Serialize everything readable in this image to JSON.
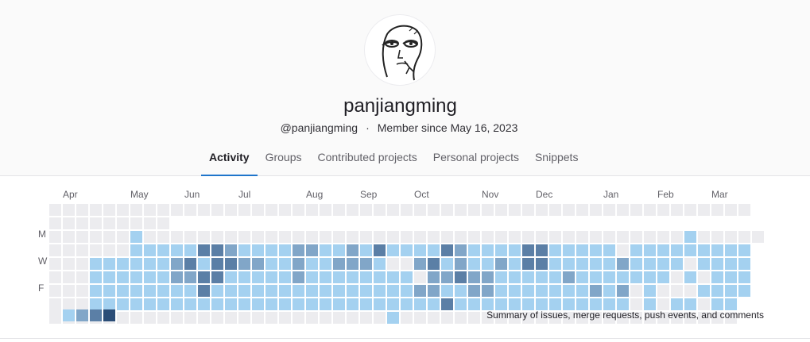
{
  "profile": {
    "username": "panjiangming",
    "handle": "@panjiangming",
    "separator": "·",
    "member_since": "Member since May 16, 2023"
  },
  "tabs": [
    {
      "label": "Activity",
      "active": true
    },
    {
      "label": "Groups",
      "active": false
    },
    {
      "label": "Contributed projects",
      "active": false
    },
    {
      "label": "Personal projects",
      "active": false
    },
    {
      "label": "Snippets",
      "active": false
    }
  ],
  "calendar": {
    "months": [
      {
        "label": "Apr",
        "week": 1
      },
      {
        "label": "May",
        "week": 6
      },
      {
        "label": "Jun",
        "week": 10
      },
      {
        "label": "Jul",
        "week": 14
      },
      {
        "label": "Aug",
        "week": 19
      },
      {
        "label": "Sep",
        "week": 23
      },
      {
        "label": "Oct",
        "week": 27
      },
      {
        "label": "Nov",
        "week": 32
      },
      {
        "label": "Dec",
        "week": 36
      },
      {
        "label": "Jan",
        "week": 41
      },
      {
        "label": "Feb",
        "week": 45
      },
      {
        "label": "Mar",
        "week": 49
      }
    ],
    "day_labels": [
      {
        "label": "M",
        "row": 1
      },
      {
        "label": "W",
        "row": 3
      },
      {
        "label": "F",
        "row": 5
      }
    ],
    "first_week_start_row": 0,
    "grid": [
      "0000000000000000000000000000000000000000000000000000",
      "000000000",
      "00000010000000000000000000000000000000000000000100000",
      "0000001111133211112211213111132111133111110111111111",
      "0001111112313322112112221002312112133111112111101111",
      "0001111112233111112111111110223221111121111111010111",
      "0001111111131111111111111112211221111111212010001111",
      "000111111111111111111111111113111111111111101011011",
      "000000000000000000000000010000000000000000000000000"
    ],
    "colors": [
      "#ececef",
      "#a4d1f0",
      "#81a6c8",
      "#5b7fa6",
      "#2b4d77"
    ],
    "legend_levels": [
      0,
      1,
      2,
      3,
      4
    ],
    "summary": "Summary of issues, merge requests, push events, and comments"
  }
}
